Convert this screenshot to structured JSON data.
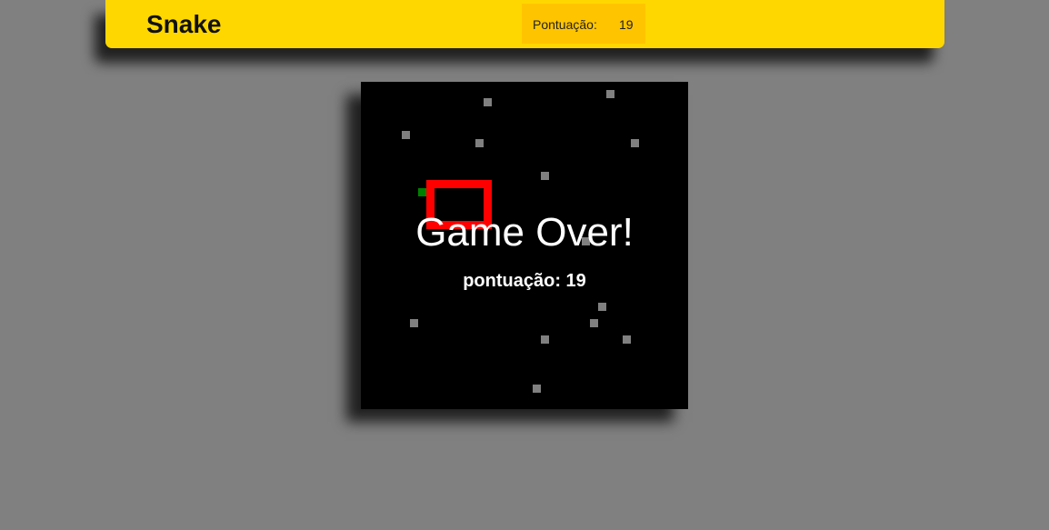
{
  "header": {
    "title": "Snake",
    "score_label": "Pontuação:",
    "score_value": "19",
    "color": "#ffd700"
  },
  "board": {
    "grid_cols": 40,
    "grid_rows": 40,
    "background": "#000000",
    "snake": {
      "color": "#ff0000",
      "head_color": "#008000",
      "head": [
        7,
        13
      ],
      "body": [
        [
          8,
          12
        ],
        [
          9,
          12
        ],
        [
          10,
          12
        ],
        [
          11,
          12
        ],
        [
          12,
          12
        ],
        [
          15,
          12
        ],
        [
          15,
          13
        ],
        [
          15,
          14
        ],
        [
          15,
          15
        ],
        [
          15,
          16
        ],
        [
          15,
          17
        ],
        [
          14,
          17
        ],
        [
          13,
          17
        ],
        [
          12,
          17
        ],
        [
          11,
          17
        ],
        [
          10,
          17
        ],
        [
          9,
          17
        ],
        [
          8,
          17
        ],
        [
          8,
          16
        ],
        [
          8,
          15
        ],
        [
          8,
          14
        ],
        [
          8,
          13
        ],
        [
          13,
          12
        ],
        [
          14,
          12
        ]
      ]
    },
    "obstacles_color": "#808080",
    "obstacles": [
      [
        15,
        2
      ],
      [
        30,
        1
      ],
      [
        5,
        6
      ],
      [
        14,
        7
      ],
      [
        33,
        7
      ],
      [
        22,
        11
      ],
      [
        27,
        19
      ],
      [
        29,
        27
      ],
      [
        6,
        29
      ],
      [
        28,
        29
      ],
      [
        22,
        31
      ],
      [
        32,
        31
      ],
      [
        21,
        37
      ]
    ],
    "game_over_text": "Game Over!",
    "final_score_text": "pontuação: 19"
  }
}
